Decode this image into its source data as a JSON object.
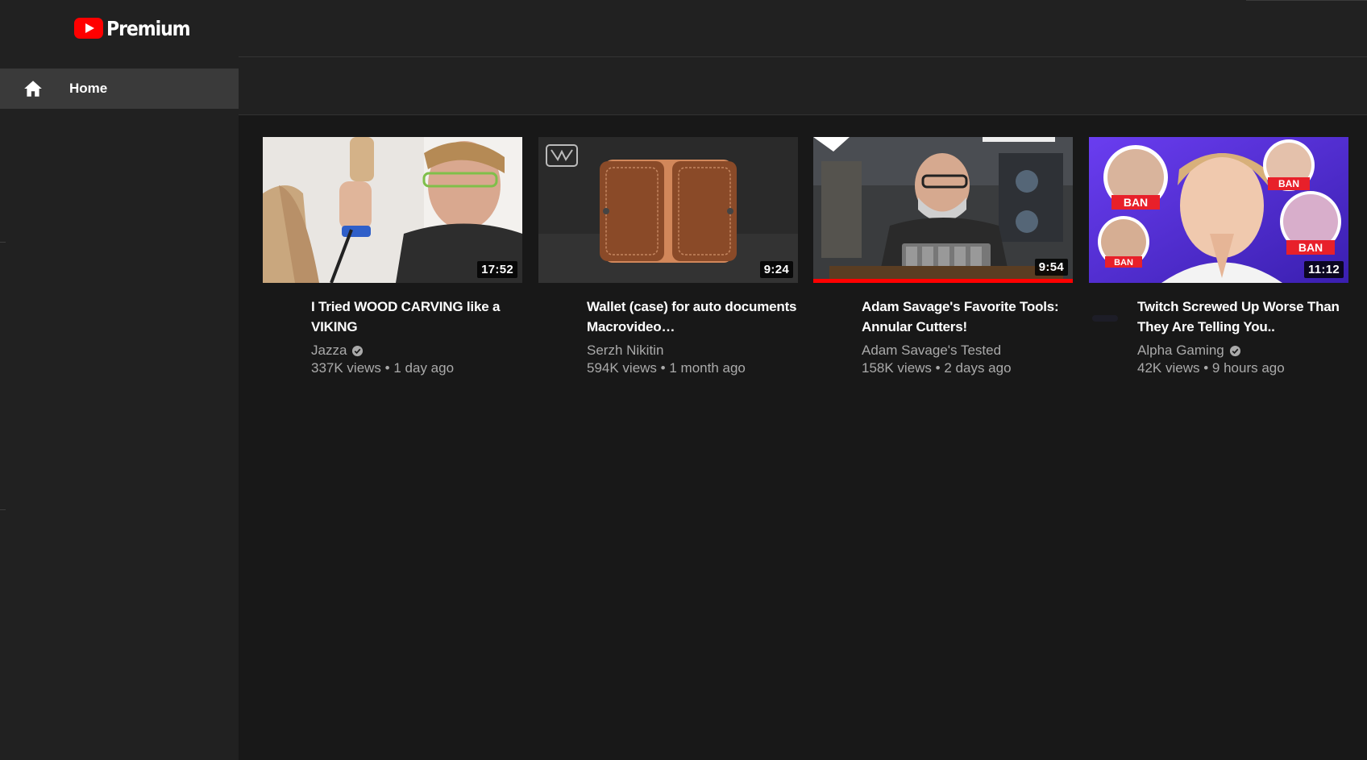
{
  "app": {
    "name": "Premium"
  },
  "sidebar": {
    "items": [
      {
        "label": "Home",
        "icon": "home-icon",
        "active": true
      }
    ]
  },
  "colors": {
    "accent": "#ff0000",
    "background": "#181818",
    "sidebar": "#212121",
    "selected": "#3a3a3a",
    "secondary_text": "#aaaaaa"
  },
  "videos": [
    {
      "title": "I Tried WOOD CARVING like a VIKING",
      "channel": "Jazza",
      "verified": true,
      "views": "337K views",
      "age": "1 day ago",
      "duration": "17:52",
      "progress": 0
    },
    {
      "title": "Wallet (case) for auto documents Macrovideo…",
      "channel": "Serzh Nikitin",
      "verified": false,
      "views": "594K views",
      "age": "1 month ago",
      "duration": "9:24",
      "progress": 0
    },
    {
      "title": "Adam Savage's Favorite Tools: Annular Cutters!",
      "channel": "Adam Savage's Tested",
      "verified": false,
      "views": "158K views",
      "age": "2 days ago",
      "duration": "9:54",
      "progress": 1.0
    },
    {
      "title": "Twitch Screwed Up Worse Than They Are Telling You..",
      "channel": "Alpha Gaming",
      "verified": true,
      "views": "42K views",
      "age": "9 hours ago",
      "duration": "11:12",
      "progress": 0
    }
  ],
  "thumbnail_text": {
    "ban_label": "BAN"
  },
  "separator": "•"
}
